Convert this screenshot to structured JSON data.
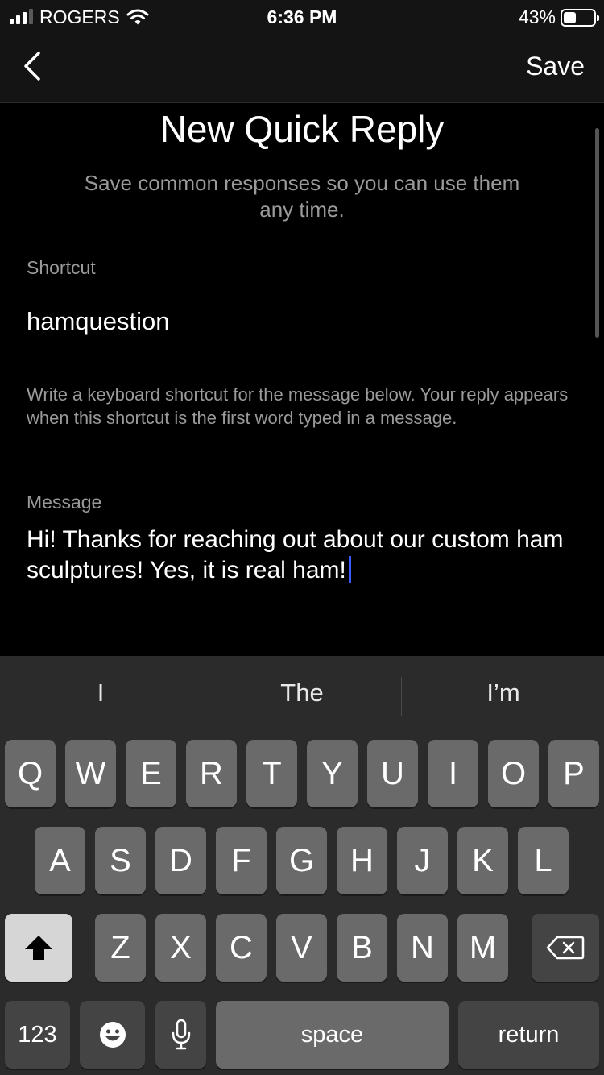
{
  "status_bar": {
    "carrier": "ROGERS",
    "time": "6:36 PM",
    "battery_percent": "43%",
    "battery_level": 0.43,
    "signal_bars": 3
  },
  "nav": {
    "back_icon": "chevron-left-icon",
    "save_label": "Save"
  },
  "form": {
    "title": "New Quick Reply",
    "subtitle": "Save common responses so you can use them any time.",
    "shortcut_label": "Shortcut",
    "shortcut_value": "hamquestion",
    "shortcut_help": "Write a keyboard shortcut for the message below. Your reply appears when this shortcut is the first word typed in a message.",
    "message_label": "Message",
    "message_value": "Hi! Thanks for reaching out about our custom ham sculptures! Yes, it is real ham!"
  },
  "keyboard": {
    "suggestions": [
      "I",
      "The",
      "I’m"
    ],
    "row1": [
      "Q",
      "W",
      "E",
      "R",
      "T",
      "Y",
      "U",
      "I",
      "O",
      "P"
    ],
    "row2": [
      "A",
      "S",
      "D",
      "F",
      "G",
      "H",
      "J",
      "K",
      "L"
    ],
    "row3": [
      "Z",
      "X",
      "C",
      "V",
      "B",
      "N",
      "M"
    ],
    "numbers_label": "123",
    "space_label": "space",
    "return_label": "return",
    "shift_icon": "shift-icon",
    "delete_icon": "delete-icon",
    "emoji_icon": "emoji-icon",
    "mic_icon": "microphone-icon"
  }
}
